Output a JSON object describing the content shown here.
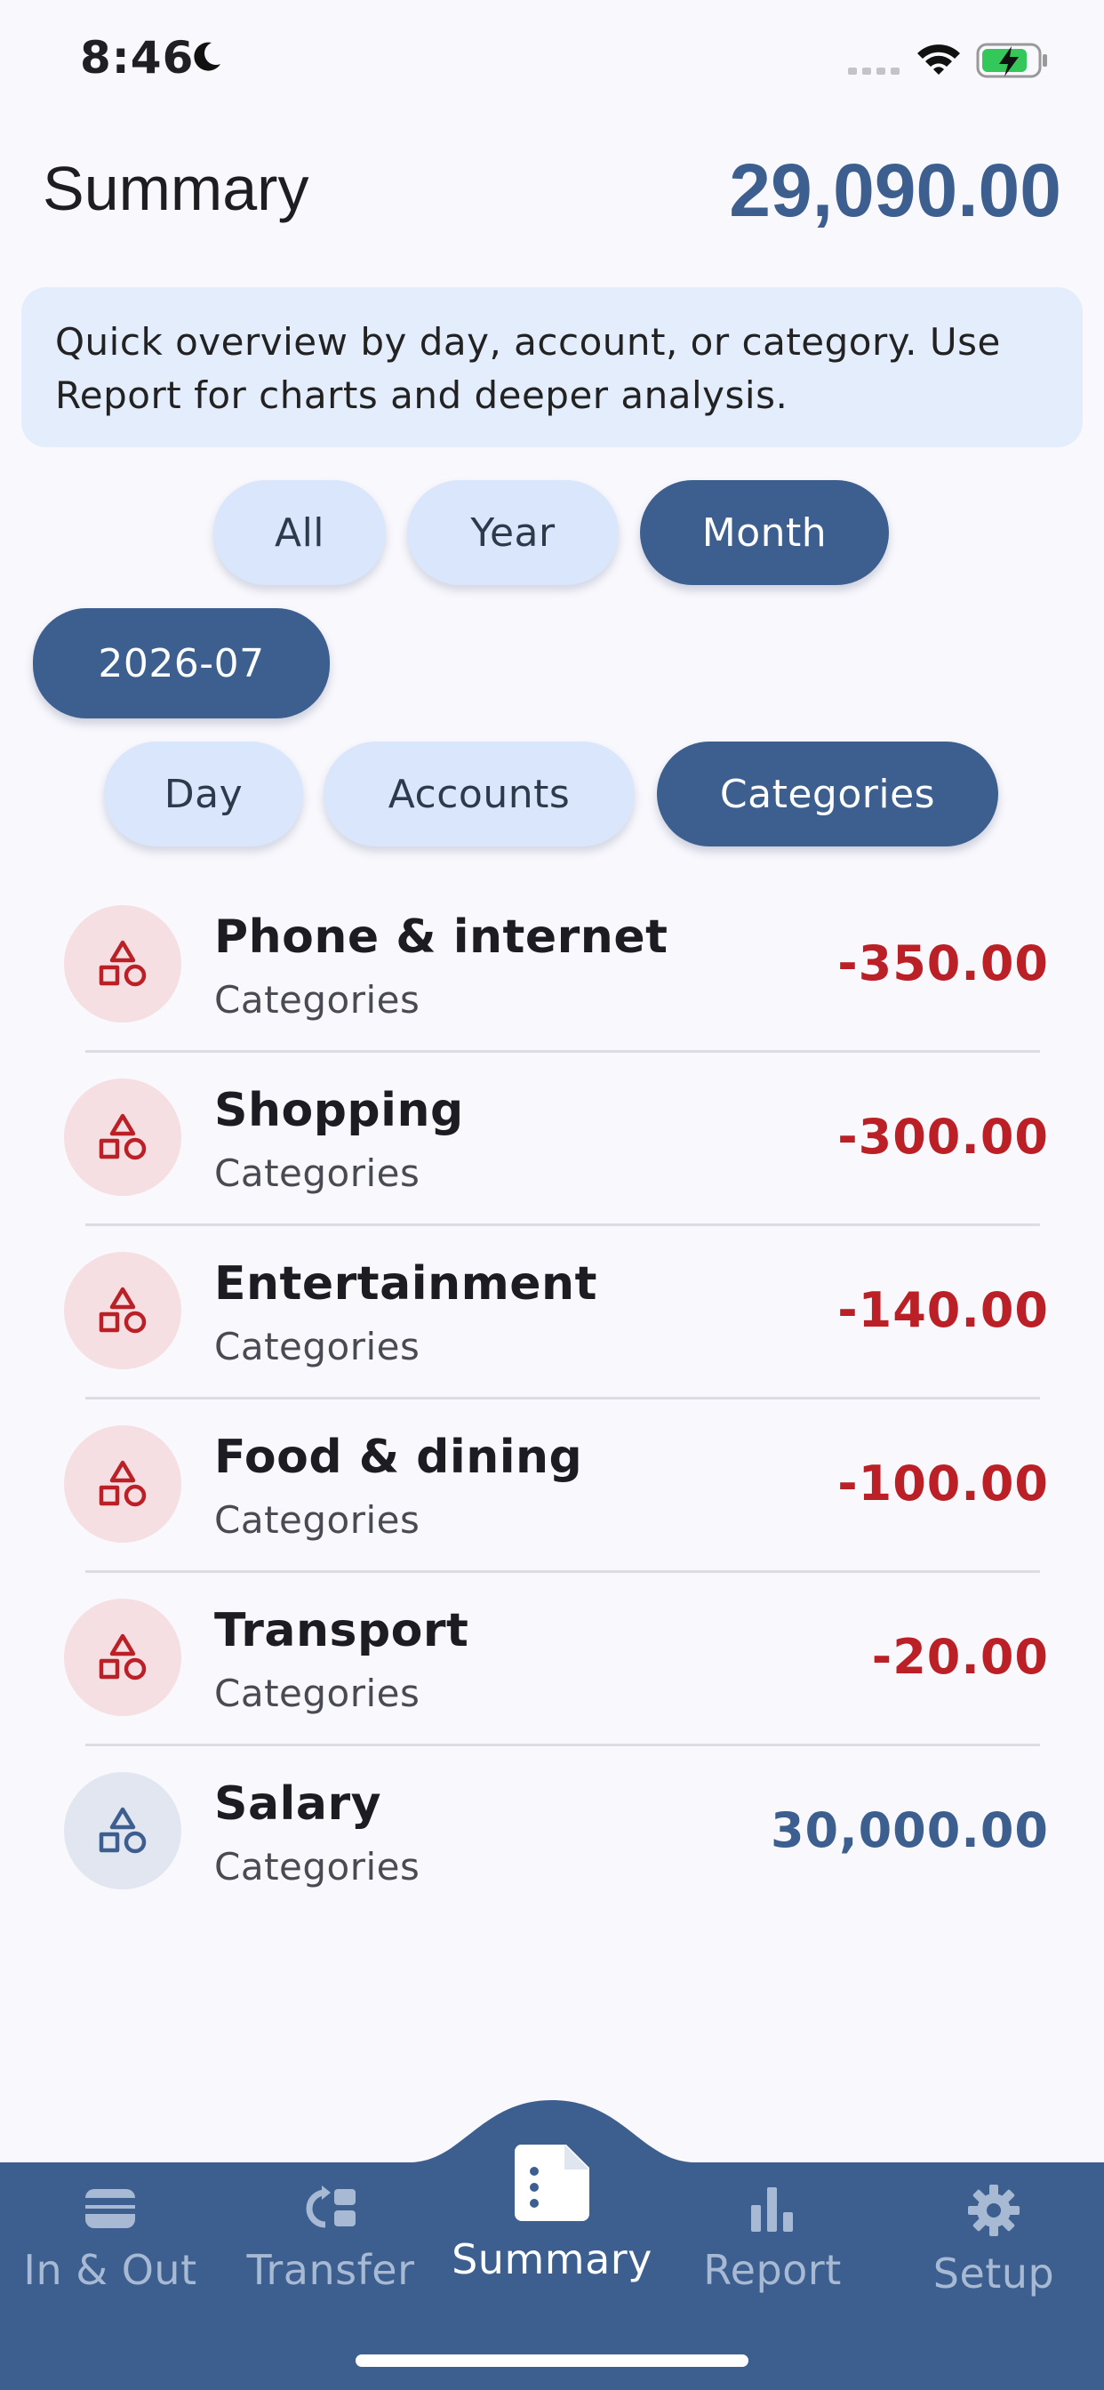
{
  "status": {
    "time": "8:46"
  },
  "header": {
    "title": "Summary",
    "total": "29,090.00"
  },
  "info": {
    "text": "Quick overview by day, account, or category. Use Report for charts and deeper analysis."
  },
  "period_filters": [
    {
      "label": "All",
      "active": false
    },
    {
      "label": "Year",
      "active": false
    },
    {
      "label": "Month",
      "active": true
    }
  ],
  "selected_period": "2026-07",
  "group_filters": [
    {
      "label": "Day",
      "active": false
    },
    {
      "label": "Accounts",
      "active": false
    },
    {
      "label": "Categories",
      "active": true
    }
  ],
  "items": [
    {
      "name": "Phone & internet",
      "sub": "Categories",
      "amount": "-350.00",
      "type": "expense"
    },
    {
      "name": "Shopping",
      "sub": "Categories",
      "amount": "-300.00",
      "type": "expense"
    },
    {
      "name": "Entertainment",
      "sub": "Categories",
      "amount": "-140.00",
      "type": "expense"
    },
    {
      "name": "Food & dining",
      "sub": "Categories",
      "amount": "-100.00",
      "type": "expense"
    },
    {
      "name": "Transport",
      "sub": "Categories",
      "amount": "-20.00",
      "type": "expense"
    },
    {
      "name": "Salary",
      "sub": "Categories",
      "amount": "30,000.00",
      "type": "income"
    }
  ],
  "nav": [
    {
      "label": "In & Out",
      "icon": "wallet-icon",
      "active": false
    },
    {
      "label": "Transfer",
      "icon": "transfer-icon",
      "active": false
    },
    {
      "label": "Summary",
      "icon": "summary-document-icon",
      "active": true
    },
    {
      "label": "Report",
      "icon": "bar-chart-icon",
      "active": false
    },
    {
      "label": "Setup",
      "icon": "gear-icon",
      "active": false
    }
  ],
  "colors": {
    "primary": "#3c5f90",
    "expense": "#bb2027",
    "chip_inactive": "#d9e6fb",
    "info_bg": "#e3edfc",
    "nav_bg": "#3c5f90"
  }
}
